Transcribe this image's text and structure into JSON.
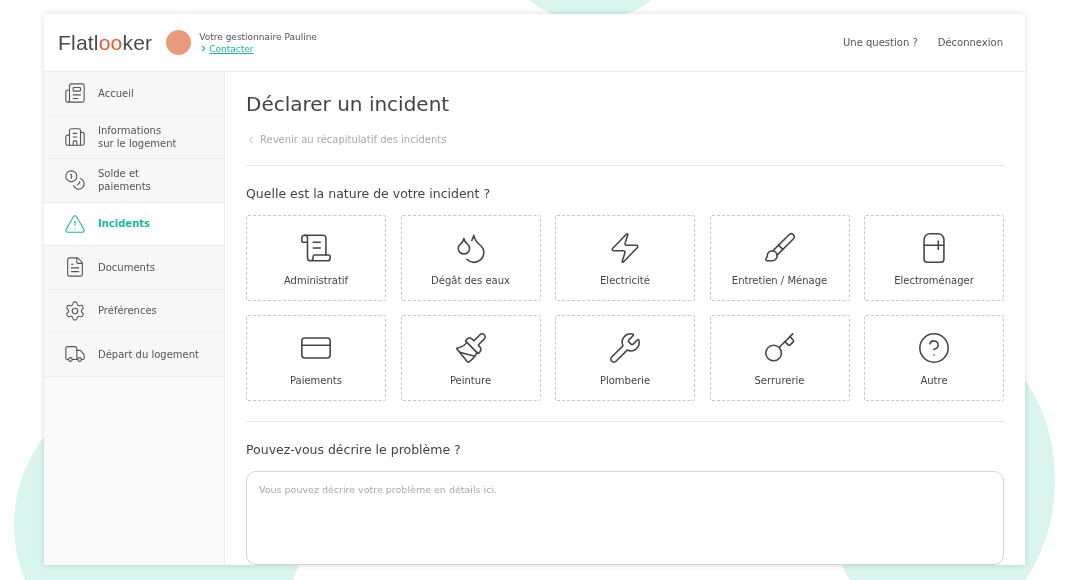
{
  "header": {
    "logo": [
      {
        "text": "Flatl",
        "accent": false
      },
      {
        "text": "oo",
        "accent": true
      },
      {
        "text": "ker",
        "accent": false
      }
    ],
    "manager": {
      "label": "Votre gestionnaire Pauline",
      "link": "Contacter"
    },
    "links": [
      "Une question ?",
      "Déconnexion"
    ]
  },
  "sidebar": {
    "items": [
      {
        "label": "Accueil",
        "selected": false
      },
      {
        "label": "Informations\nsur le logement",
        "selected": false
      },
      {
        "label": "Solde et\npaiements",
        "selected": false
      },
      {
        "label": "Incidents",
        "selected": true
      },
      {
        "label": "Documents",
        "selected": false
      },
      {
        "label": "Préférences",
        "selected": false
      },
      {
        "label": "Départ du logement",
        "selected": false
      }
    ]
  },
  "main": {
    "title": "Déclarer un incident",
    "back_link": "Revenir au récapitulatif des incidents",
    "question": "Quelle est la nature de votre incident ?",
    "categories": [
      {
        "label": "Administratif"
      },
      {
        "label": "Dégât des eaux"
      },
      {
        "label": "Electricité"
      },
      {
        "label": "Entretien / Ménage"
      },
      {
        "label": "Electroménager"
      },
      {
        "label": "Paiements"
      },
      {
        "label": "Peinture"
      },
      {
        "label": "Plomberie"
      },
      {
        "label": "Serrurerie"
      },
      {
        "label": "Autre"
      }
    ],
    "description_label": "Pouvez-vous décrire le problème ?",
    "description": {
      "placeholder": "Vous pouvez décrire votre problème en détails ici."
    }
  }
}
